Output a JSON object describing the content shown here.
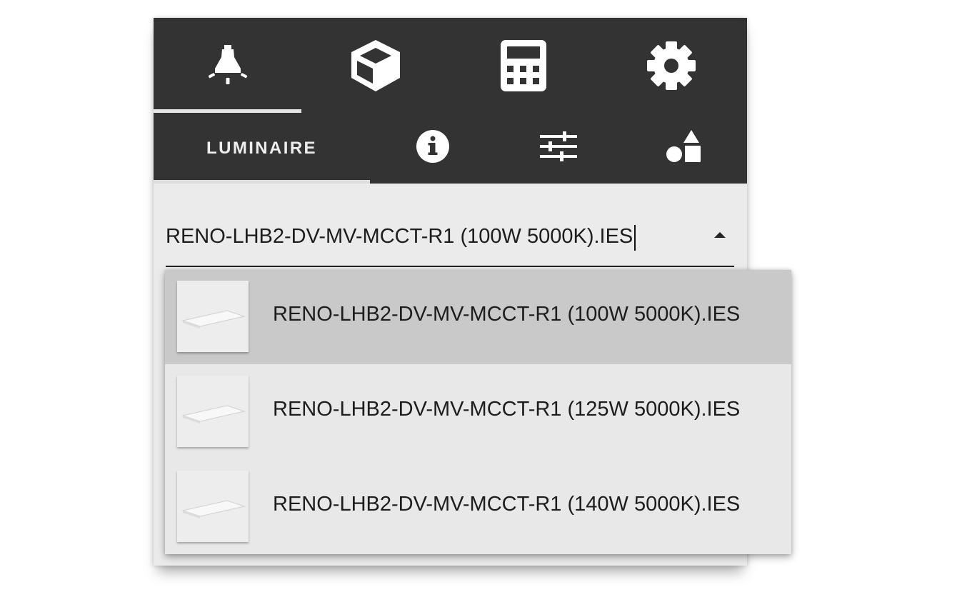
{
  "toolbar": {
    "main_tabs": [
      {
        "icon": "lamp-icon",
        "active": true
      },
      {
        "icon": "cube-icon",
        "active": false
      },
      {
        "icon": "calculator-icon",
        "active": false
      },
      {
        "icon": "gear-icon",
        "active": false
      }
    ],
    "sub_tabs": {
      "active_label": "LUMINAIRE",
      "icons": [
        "info-icon",
        "sliders-icon",
        "shapes-icon"
      ]
    }
  },
  "luminaire_select": {
    "value": "RENO-LHB2-DV-MV-MCCT-R1 (100W 5000K).IES",
    "expanded": true
  },
  "dropdown": {
    "options": [
      {
        "label": "RENO-LHB2-DV-MV-MCCT-R1 (100W 5000K).IES",
        "selected": true
      },
      {
        "label": "RENO-LHB2-DV-MV-MCCT-R1 (125W 5000K).IES",
        "selected": false
      },
      {
        "label": "RENO-LHB2-DV-MV-MCCT-R1 (140W 5000K).IES",
        "selected": false
      }
    ]
  },
  "colors": {
    "toolbar_bg": "#333333",
    "panel_bg": "#ebebeb",
    "selected_option_bg": "#c9c9c9"
  }
}
